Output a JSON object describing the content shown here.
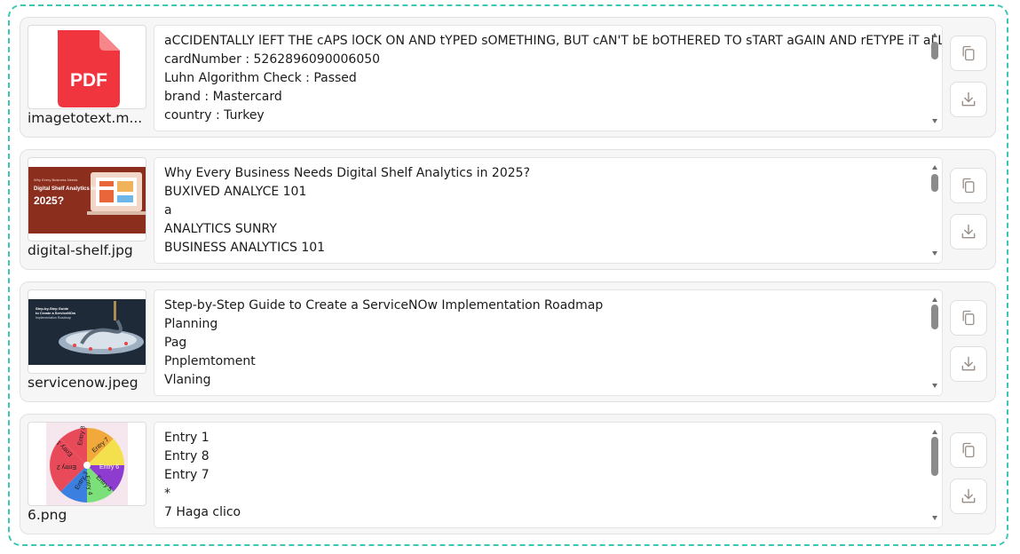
{
  "colors": {
    "accent_border": "#3cc7b5",
    "pdf_red": "#f0353e",
    "icon_gray": "#9a8f88"
  },
  "items": [
    {
      "filename": "imagetotext.m...",
      "thumb_icon": "pdf-file-icon",
      "pdf_label": "PDF",
      "lines": [
        "aCCIDENTALLY lEFT THE cAPS lOCK ON AND tYPED sOMETHING, BUT cAN'T bE bOTHERED TO sTART aGAIN AND rETYPE iT aLL?",
        "cardNumber : 5262896090006050",
        "Luhn Algorithm Check : Passed",
        "brand : Mastercard",
        "country : Turkey"
      ],
      "copy_icon": "copy-icon",
      "download_icon": "download-icon"
    },
    {
      "filename": "digital-shelf.jpg",
      "thumb_icon": "image-thumbnail",
      "thumb_text_small": "Why Every Business Needs",
      "thumb_text_mid": "Digital Shelf Analytics in",
      "thumb_text_big": "2025?",
      "lines": [
        "Why Every Business Needs Digital Shelf Analytics in 2025?",
        "BUXIVED ANALYCE 101",
        "a",
        "ANALYTICS SUNRY",
        "BUSINESS ANALYTICS 101"
      ],
      "copy_icon": "copy-icon",
      "download_icon": "download-icon"
    },
    {
      "filename": "servicenow.jpeg",
      "thumb_icon": "image-thumbnail",
      "thumb_text_1": "Step-by-Step Guide",
      "thumb_text_2": "to Create a ServiceNOw",
      "thumb_text_3": "Implementation Roadmap",
      "lines": [
        "Step-by-Step Guide to Create a ServiceNOw Implementation Roadmap",
        "Planning",
        "Pag",
        "Pnplemtoment",
        "Vlaning"
      ],
      "copy_icon": "copy-icon",
      "download_icon": "download-icon"
    },
    {
      "filename": "6.png",
      "thumb_icon": "image-thumbnail",
      "wheel_labels": [
        "Entry 8",
        "Entry 7",
        "Entry 6",
        "Entry 5",
        "Entry 4",
        "Entry 3",
        "Entry 2",
        "Entry 1"
      ],
      "lines": [
        "Entry 1",
        "Entry 8",
        "Entry 7",
        "*",
        "7 Haga clico"
      ],
      "copy_icon": "copy-icon",
      "download_icon": "download-icon"
    }
  ]
}
